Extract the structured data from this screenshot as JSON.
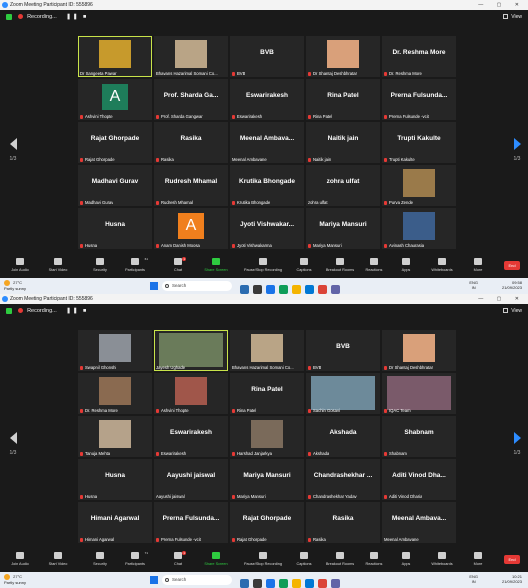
{
  "window": {
    "title_top": "Zoom Meeting Participant ID: 555896",
    "title_bottom": "Zoom Meeting Participant ID: 555896",
    "window_controls": "— ▢ ✕"
  },
  "recording": {
    "label": "Recording...",
    "controls": "❚❚ ■"
  },
  "view_label": "View",
  "screen1": {
    "page": "1/3",
    "tiles": [
      {
        "type": "photo",
        "big": "",
        "name": "Dr Sangeeta Pawar",
        "muted": false,
        "active": true,
        "photo_color": "#c79a2c"
      },
      {
        "type": "photo",
        "big": "",
        "name": "Bhavans Hazarimal Somani Co...",
        "muted": false,
        "photo_color": "#b9a486"
      },
      {
        "type": "text",
        "big": "BVB",
        "name": "BVB",
        "muted": true
      },
      {
        "type": "photo",
        "big": "",
        "name": "Dr Shantaj Deshbhratar",
        "muted": true,
        "photo_color": "#d9a07a"
      },
      {
        "type": "text",
        "big": "Dr. Reshma More",
        "name": "Dr. Reshma More",
        "muted": true
      },
      {
        "type": "avatar",
        "big": "A",
        "name": "Ashvini Thopte",
        "muted": true,
        "avatar_color": "#1e7d5a"
      },
      {
        "type": "text",
        "big": "Prof. Sharda Ga...",
        "name": "Prof. Sharda Gangwar",
        "muted": true
      },
      {
        "type": "text",
        "big": "Eswarirakesh",
        "name": "Eswarirakesh",
        "muted": true
      },
      {
        "type": "text",
        "big": "Rina Patel",
        "name": "Rina Patel",
        "muted": true
      },
      {
        "type": "text",
        "big": "Prerna  Fulsunda...",
        "name": "Prerna Fulsunde -vcit",
        "muted": true
      },
      {
        "type": "text",
        "big": "Rajat Ghorpade",
        "name": "Rajat Ghorpade",
        "muted": true
      },
      {
        "type": "text",
        "big": "Rasika",
        "name": "Rasika",
        "muted": true
      },
      {
        "type": "text",
        "big": "Meenal  Ambava...",
        "name": "Meenal Ambavane",
        "muted": false
      },
      {
        "type": "text",
        "big": "Naitik jain",
        "name": "Naitik jain",
        "muted": true
      },
      {
        "type": "text",
        "big": "Trupti Kakulte",
        "name": "Trupti Kakulte",
        "muted": true
      },
      {
        "type": "text",
        "big": "Madhavi Gurav",
        "name": "Madhavi Gurav",
        "muted": true
      },
      {
        "type": "text",
        "big": "Rudresh Mhamal",
        "name": "Rudresh Mhamal",
        "muted": true
      },
      {
        "type": "text",
        "big": "Krutika Bhongade",
        "name": "Krutika Bhongade",
        "muted": true
      },
      {
        "type": "text",
        "big": "zohra ulfat",
        "name": "zohra ulfat",
        "muted": false
      },
      {
        "type": "photo",
        "big": "",
        "name": "Purva Zende",
        "muted": true,
        "photo_color": "#9a7a4a"
      },
      {
        "type": "text",
        "big": "Husna",
        "name": "Husna",
        "muted": true
      },
      {
        "type": "avatar",
        "big": "A",
        "name": "Anam Danish Moosa",
        "muted": true,
        "avatar_color": "#f07f1d"
      },
      {
        "type": "text",
        "big": "Jyoti  Vishwakar...",
        "name": "Jyoti Vishwakarma",
        "muted": true
      },
      {
        "type": "text",
        "big": "Mariya Mansuri",
        "name": "Mariya Mansuri",
        "muted": true
      },
      {
        "type": "photo",
        "big": "",
        "name": "Avinash Chaurasia",
        "muted": true,
        "photo_color": "#3b5d8a"
      }
    ],
    "participants_count": "61",
    "chat_badge": "1",
    "time": "09:58",
    "date": "21/09/2023"
  },
  "screen2": {
    "page": "1/3",
    "tiles": [
      {
        "type": "photo",
        "big": "",
        "name": "Swapnil Ghonshi",
        "muted": true,
        "photo_color": "#8a8f96"
      },
      {
        "type": "photo",
        "big": "",
        "name": "Jayesh Ughade",
        "muted": false,
        "active": true,
        "photo_color": "#6a7b5a",
        "wide": true
      },
      {
        "type": "photo",
        "big": "",
        "name": "Bhavans Hazarimal Somani Co...",
        "muted": false,
        "photo_color": "#b9a486"
      },
      {
        "type": "text",
        "big": "BVB",
        "name": "BVB",
        "muted": true
      },
      {
        "type": "photo",
        "big": "",
        "name": "Dr Shantaj Deshbhratar",
        "muted": true,
        "photo_color": "#d9a07a"
      },
      {
        "type": "photo",
        "big": "",
        "name": "Dr. Reshma More",
        "muted": true,
        "photo_color": "#8a6a50"
      },
      {
        "type": "photo",
        "big": "",
        "name": "Ashvini Thopte",
        "muted": true,
        "photo_color": "#a0564a"
      },
      {
        "type": "text",
        "big": "Rina Patel",
        "name": "Rina Patel",
        "muted": true
      },
      {
        "type": "photo",
        "big": "",
        "name": "Sachin Gosavi",
        "muted": true,
        "photo_color": "#6d8a9a",
        "wide": true
      },
      {
        "type": "photo",
        "big": "",
        "name": "IQAC Team",
        "muted": true,
        "photo_color": "#7a5a6a",
        "wide": true
      },
      {
        "type": "photo",
        "big": "",
        "name": "Tanuja Mehta",
        "muted": true,
        "photo_color": "#b5a28a"
      },
      {
        "type": "text",
        "big": "Eswarirakesh",
        "name": "Eswarirakesh",
        "muted": true
      },
      {
        "type": "photo",
        "big": "",
        "name": "Harshad Janjarkya",
        "muted": true,
        "photo_color": "#7a6a5a"
      },
      {
        "type": "text",
        "big": "Akshada",
        "name": "Akshada",
        "muted": true
      },
      {
        "type": "text",
        "big": "Shabnam",
        "name": "Shabnam",
        "muted": true
      },
      {
        "type": "text",
        "big": "Husna",
        "name": "Husna",
        "muted": true
      },
      {
        "type": "text",
        "big": "Aayushi jaiswal",
        "name": "Aayushi jaiswal",
        "muted": false
      },
      {
        "type": "text",
        "big": "Mariya Mansuri",
        "name": "Mariya Mansuri",
        "muted": true
      },
      {
        "type": "text",
        "big": "Chandrashekhar ...",
        "name": "Chandrashekhar Yadav",
        "muted": true
      },
      {
        "type": "text",
        "big": "Aditi  Vinod  Dha...",
        "name": "Aditi Vinod Dharia",
        "muted": true
      },
      {
        "type": "text",
        "big": "Himani Agarwal",
        "name": "Himani Agarwal",
        "muted": true
      },
      {
        "type": "text",
        "big": "Prerna  Fulsunda...",
        "name": "Prerna Fulsunde -vcit",
        "muted": true
      },
      {
        "type": "text",
        "big": "Rajat Ghorpade",
        "name": "Rajat Ghorpade",
        "muted": true
      },
      {
        "type": "text",
        "big": "Rasika",
        "name": "Rasika",
        "muted": true
      },
      {
        "type": "text",
        "big": "Meenal  Ambava...",
        "name": "Meenal Ambavane",
        "muted": false
      }
    ],
    "participants_count": "71",
    "chat_badge": "1",
    "time": "10:21",
    "date": "21/09/2023"
  },
  "toolbar": {
    "join_audio": "Join Audio",
    "start_video": "Start Video",
    "security": "Security",
    "participants": "Participants",
    "chat": "Chat",
    "share_screen": "Share Screen",
    "pause_recording": "Pause/Stop Recording",
    "captions": "Captions",
    "breakout": "Breakout Rooms",
    "reactions": "Reactions",
    "apps": "Apps",
    "whiteboards": "Whiteboards",
    "more": "More",
    "end": "End"
  },
  "taskbar": {
    "temp": "27°C",
    "condition": "Partly sunny",
    "search": "Search",
    "lang": "ENG",
    "region": "IN",
    "app_colors": [
      "#2b6cb0",
      "#3a3a3a",
      "#1a73e8",
      "#0f9d58",
      "#f4b400",
      "#0078d4",
      "#db4437",
      "#6264a7"
    ]
  },
  "colors": {
    "accent": "#2d8cff",
    "active_outline": "#c8e34a",
    "end_red": "#e53935",
    "share_green": "#2ecc40"
  }
}
